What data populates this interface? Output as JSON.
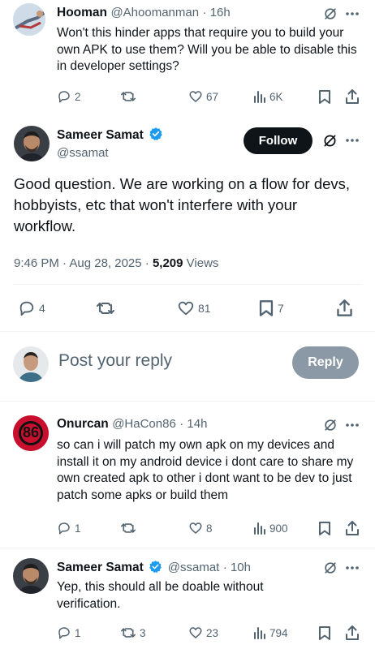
{
  "reply1": {
    "name": "Hooman",
    "handle": "@Ahoomanman",
    "time": "· 16h",
    "text": "Won't this hinder apps that require you to build your own APK to use them? Will you be able to disable this in developer settings?",
    "replies": "2",
    "likes": "67",
    "views": "6K"
  },
  "main": {
    "name": "Sameer Samat",
    "handle": "@ssamat",
    "follow_label": "Follow",
    "text": "Good question.  We are working on a flow for devs, hobbyists, etc that won't interfere with your workflow.",
    "time": "9:46 PM · Aug 28, 2025 · ",
    "views_count": "5,209",
    "views_label": " Views",
    "replies": "4",
    "likes": "81",
    "bookmarks": "7"
  },
  "compose": {
    "placeholder": "Post your reply",
    "reply_label": "Reply"
  },
  "reply2": {
    "name": "Onurcan",
    "handle": "@HaCon86",
    "time": "· 14h",
    "avatar_text": "86",
    "text": "so can i will patch my own apk on my devices and install it on my android device i dont care to share my own created apk to other i dont want to be dev to just patch some apks or build them",
    "replies": "1",
    "likes": "8",
    "views": "900"
  },
  "reply3": {
    "name": "Sameer Samat",
    "handle": "@ssamat",
    "time": "· 10h",
    "text": "Yep, this should all be doable without verification.",
    "replies": "1",
    "reposts": "3",
    "likes": "23",
    "views": "794"
  },
  "colors": {
    "verified": "#1d9bf0",
    "follow_bg": "#0f1419",
    "reply_btn_bg": "#8b98a5",
    "secondary_text": "#536471",
    "onurcan_avatar": "#c8102e"
  }
}
